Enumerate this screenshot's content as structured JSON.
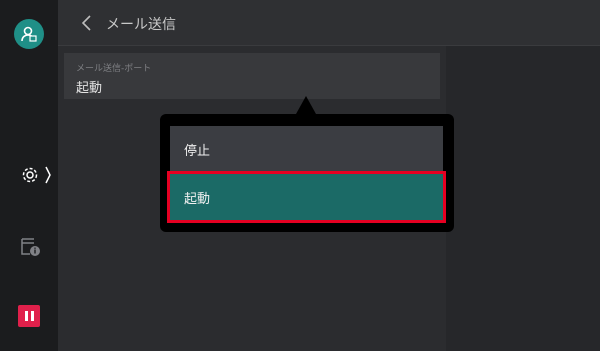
{
  "header": {
    "title": "メール送信"
  },
  "field": {
    "label": "メール送信-ポート",
    "value": "起動"
  },
  "popup": {
    "options": [
      {
        "label": "停止"
      },
      {
        "label": "起動",
        "selected": true
      }
    ]
  },
  "colors": {
    "accent": "#1b6a66",
    "highlight": "#e60022",
    "stop": "#e0204b"
  },
  "icons": {
    "sidebar": [
      "user-icon",
      "settings-icon",
      "print-queue-icon",
      "stop-icon"
    ],
    "header": [
      "back-icon"
    ]
  }
}
